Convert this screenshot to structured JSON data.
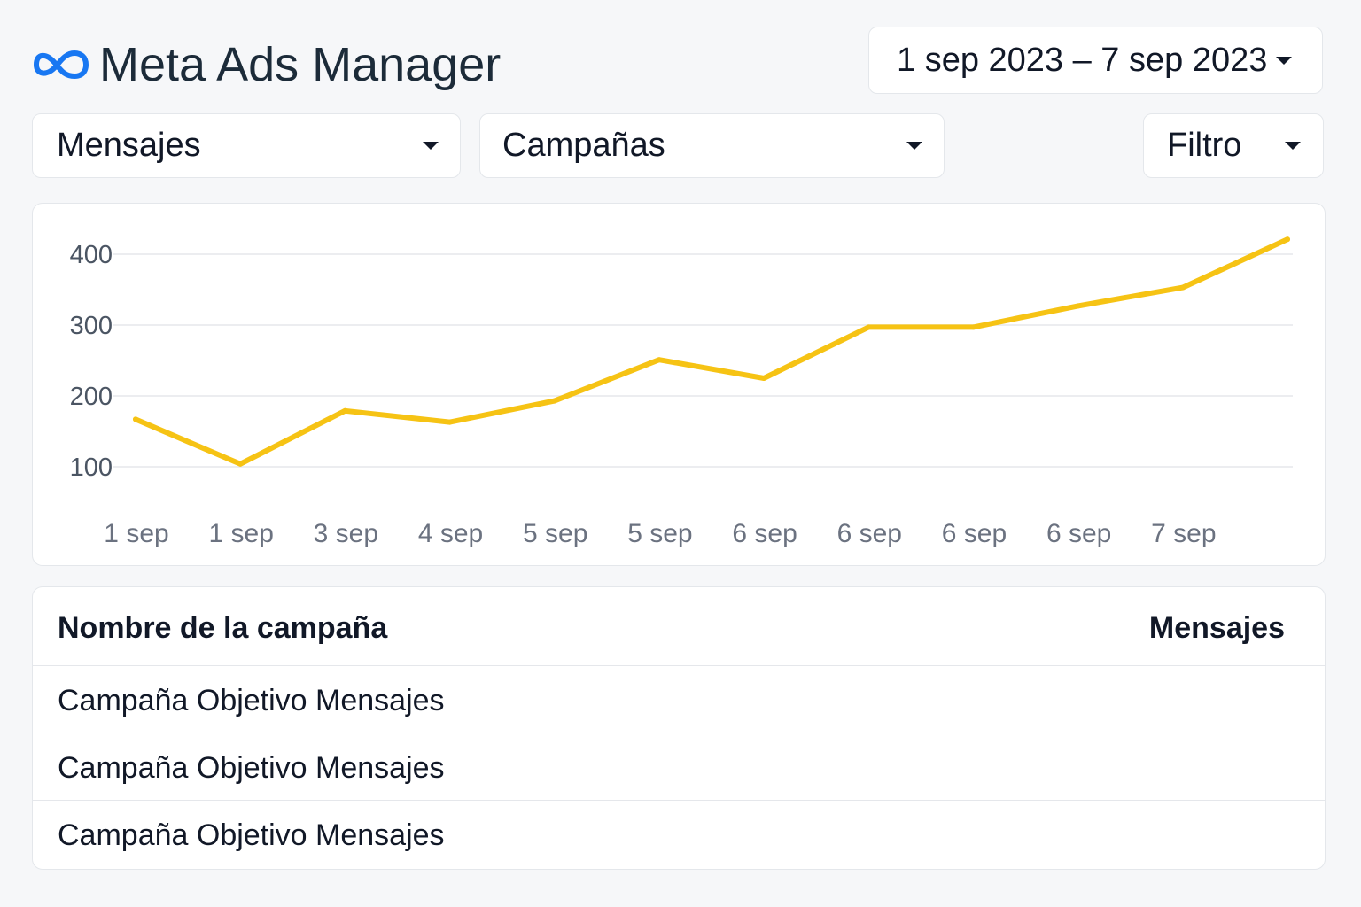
{
  "header": {
    "title": "Meta Ads Manager",
    "logo_icon": "meta-infinity-icon",
    "date_range": "1 sep 2023 – 7 sep 2023"
  },
  "controls": {
    "metric": "Mensajes",
    "level": "Campañas",
    "filter": "Filtro"
  },
  "colors": {
    "line": "#f6c314",
    "accent_blue": "#1877f2"
  },
  "chart_data": {
    "type": "line",
    "categories": [
      "1 sep",
      "1 sep",
      "3 sep",
      "4 sep",
      "5 sep",
      "5 sep",
      "6 sep",
      "6 sep",
      "6 sep",
      "6 sep",
      "7 sep",
      ""
    ],
    "values": [
      167,
      104,
      179,
      163,
      193,
      251,
      225,
      297,
      297,
      327,
      353,
      421
    ],
    "y_ticks": [
      400,
      300,
      200,
      100
    ],
    "ylim": [
      100,
      400
    ],
    "grid": true,
    "title": "",
    "xlabel": "",
    "ylabel": ""
  },
  "table": {
    "columns": [
      "Nombre de la campaña",
      "Mensajes"
    ],
    "rows": [
      {
        "name": "Campaña Objetivo Mensajes",
        "value": ""
      },
      {
        "name": "Campaña Objetivo Mensajes",
        "value": ""
      },
      {
        "name": "Campaña Objetivo Mensajes",
        "value": ""
      }
    ]
  }
}
